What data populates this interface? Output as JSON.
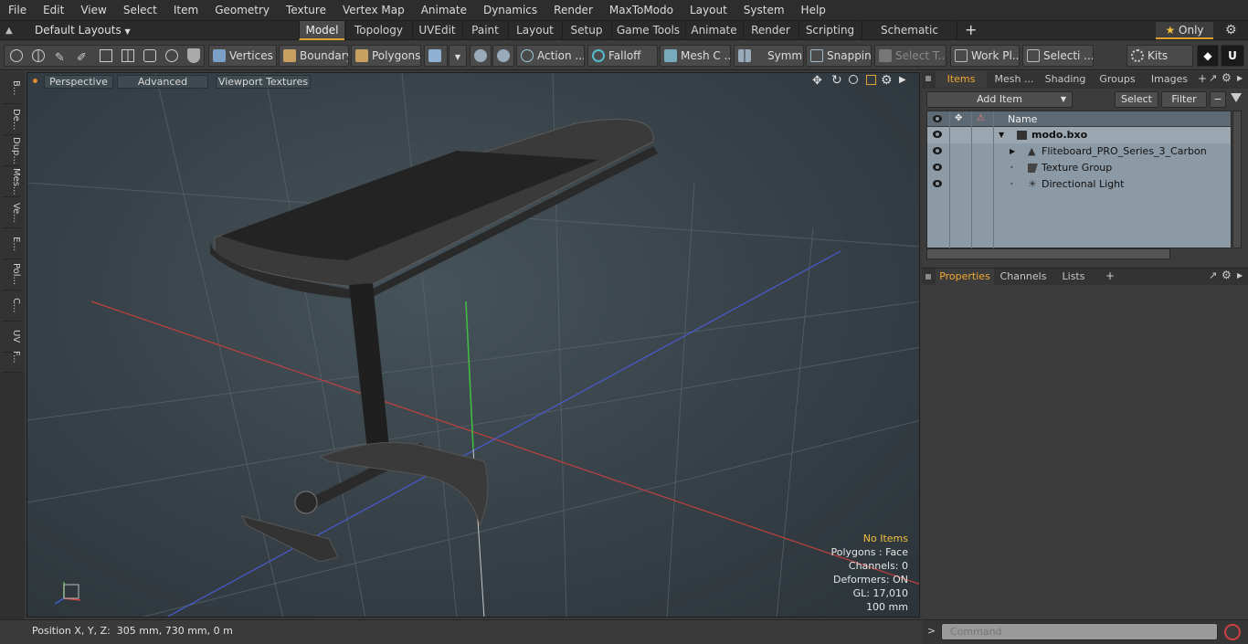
{
  "menu": [
    "File",
    "Edit",
    "View",
    "Select",
    "Item",
    "Geometry",
    "Texture",
    "Vertex Map",
    "Animate",
    "Dynamics",
    "Render",
    "MaxToModo",
    "Layout",
    "System",
    "Help"
  ],
  "layout_selector": "Default Layouts",
  "tabs": [
    "Model",
    "Topology",
    "UVEdit",
    "Paint",
    "Layout",
    "Setup",
    "Game Tools",
    "Animate",
    "Render",
    "Scripting",
    "Schematic Fusion"
  ],
  "tabs_add": "+",
  "only_label": "Only",
  "toolbar": {
    "vertices": "Vertices",
    "boundary": "Boundary",
    "polygons": "Polygons",
    "action": "Action",
    "action_more": "...",
    "falloff": "Falloff",
    "mesh": "Mesh C ...",
    "symmetry": "Symm ...",
    "snapping": "Snapping",
    "select_tool": "Select T...",
    "work_plane": "Work Pl...",
    "selection": "Selecti ...",
    "kits": "Kits"
  },
  "left_tabs": [
    "B...",
    "De...",
    "Dup...",
    "Mes...",
    "Ve...",
    "E...",
    "Pol...",
    "C...",
    "UV",
    "F..."
  ],
  "viewport": {
    "perspective": "Perspective",
    "advanced": "Advanced",
    "textures": "Viewport Textures",
    "info": {
      "no_items": "No Items",
      "polygons": "Polygons : Face",
      "channels": "Channels: 0",
      "deformers": "Deformers: ON",
      "gl": "GL: 17,010",
      "scale": "100 mm"
    }
  },
  "status": {
    "position": "Position X, Y, Z:  305 mm, 730 mm, 0 m"
  },
  "right_tabs": [
    "Items",
    "Mesh ...",
    "Shading",
    "Groups",
    "Images"
  ],
  "add_item": "Add Item",
  "select_btn": "Select",
  "filter_btn": "Filter",
  "list_header": "Name",
  "items": [
    {
      "name": "modo.bxo"
    },
    {
      "name": "Fliteboard_PRO_Series_3_Carbon"
    },
    {
      "name": "Texture Group"
    },
    {
      "name": "Directional Light"
    }
  ],
  "prop_tabs": [
    "Properties",
    "Channels",
    "Lists"
  ],
  "command_placeholder": "Command",
  "colors": {
    "accent": "#e0a030",
    "info_yellow": "#f0c040"
  }
}
